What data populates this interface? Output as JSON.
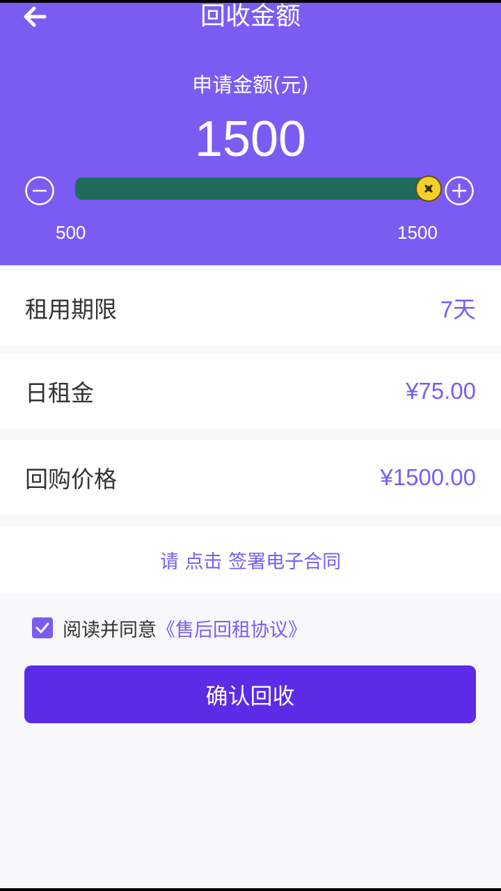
{
  "header": {
    "title": "回收金额",
    "amount_label": "申请金额(元)",
    "amount_value": "1500",
    "slider": {
      "min": 500,
      "max": 1500,
      "value": 1500
    },
    "range_min_label": "500",
    "range_max_label": "1500"
  },
  "details": {
    "term_label": "租用期限",
    "term_value": "7天",
    "daily_rent_label": "日租金",
    "daily_rent_value": "¥75.00",
    "buyback_label": "回购价格",
    "buyback_value": "¥1500.00"
  },
  "contract_link": "请 点击 签署电子合同",
  "agreement": {
    "checked": true,
    "text": "阅读并同意",
    "link": "《售后回租协议》"
  },
  "confirm_button": "确认回收",
  "colors": {
    "header_bg": "#7b5cf3",
    "slider_fill": "#1f6b5b",
    "thumb": "#f2d02c",
    "accent": "#7b5cf3",
    "button_bg": "#5b2be8"
  },
  "icons": [
    "back-arrow-icon",
    "minus-circle-icon",
    "plus-circle-icon",
    "slider-thumb-icon",
    "check-icon"
  ]
}
